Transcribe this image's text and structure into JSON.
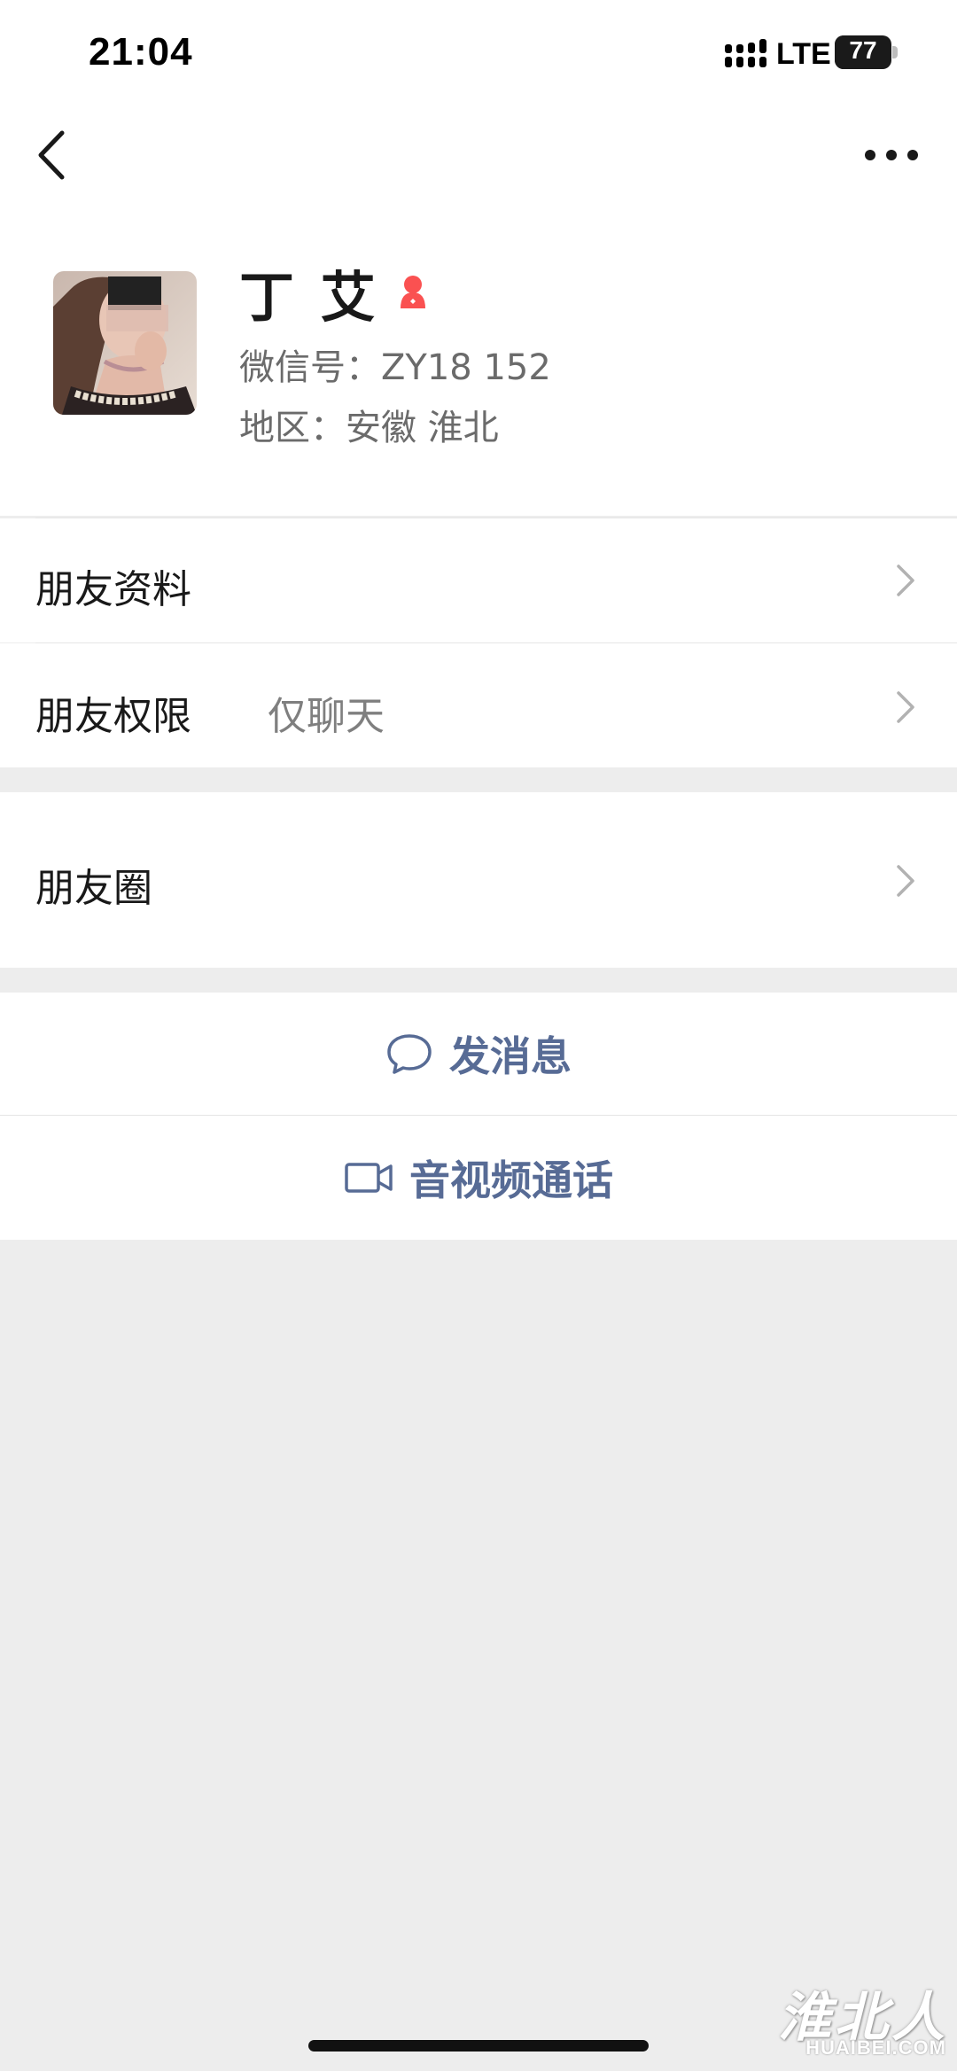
{
  "status_bar": {
    "time": "21:04",
    "network": "LTE",
    "battery_percent": "77",
    "battery_level": 0.77,
    "signal_icon": "signal-bars-icon"
  },
  "nav": {
    "back_icon": "chevron-left-icon",
    "more_icon": "ellipsis-icon"
  },
  "profile": {
    "nickname": "丁 艾",
    "gender_icon": "female-icon",
    "gender_color": "#fa5151",
    "wechat_id": "微信号：ZY18 152",
    "region": "地区：安徽 淮北"
  },
  "rows": [
    {
      "label": "朋友资料",
      "value": ""
    },
    {
      "label": "朋友权限",
      "value": "仅聊天"
    },
    {
      "label": "朋友圈",
      "value": ""
    }
  ],
  "actions": {
    "message": {
      "label": "发消息",
      "icon": "chat-bubble-icon"
    },
    "call": {
      "label": "音视频通话",
      "icon": "video-camera-icon"
    }
  },
  "colors": {
    "link_blue": "#576b95",
    "page_background": "#ededed"
  },
  "watermark": {
    "chinese": "淮北人",
    "english": "HUAIBEI.COM"
  }
}
